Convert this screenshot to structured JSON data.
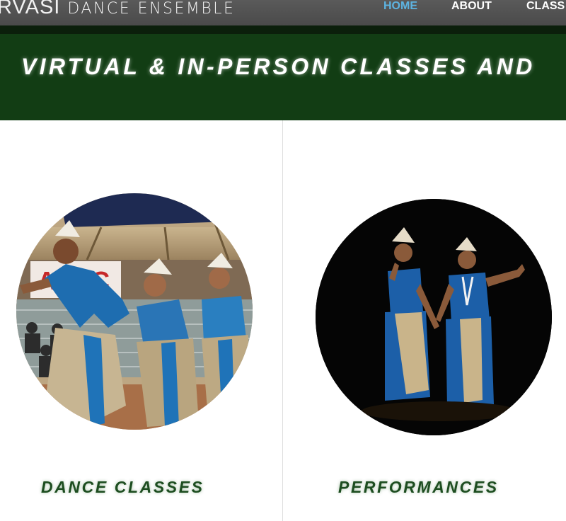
{
  "header": {
    "logo_main": "RVASI",
    "logo_sub": "DANCE ENSEMBLE",
    "nav": [
      {
        "label": "HOME",
        "active": true
      },
      {
        "label": "ABOUT",
        "active": false
      },
      {
        "label": "CLASS",
        "active": false
      }
    ],
    "colors": {
      "bar": "#4f4f4f",
      "active": "#5db3e0"
    }
  },
  "banner": {
    "text": "VIRTUAL & IN-PERSON CLASSES AND",
    "color": "#123d14"
  },
  "cards": [
    {
      "title": "DANCE CLASSES",
      "image": "dance-classes-photo"
    },
    {
      "title": "PERFORMANCES",
      "image": "performances-photo"
    }
  ],
  "photo_sign_text": "ASCC"
}
